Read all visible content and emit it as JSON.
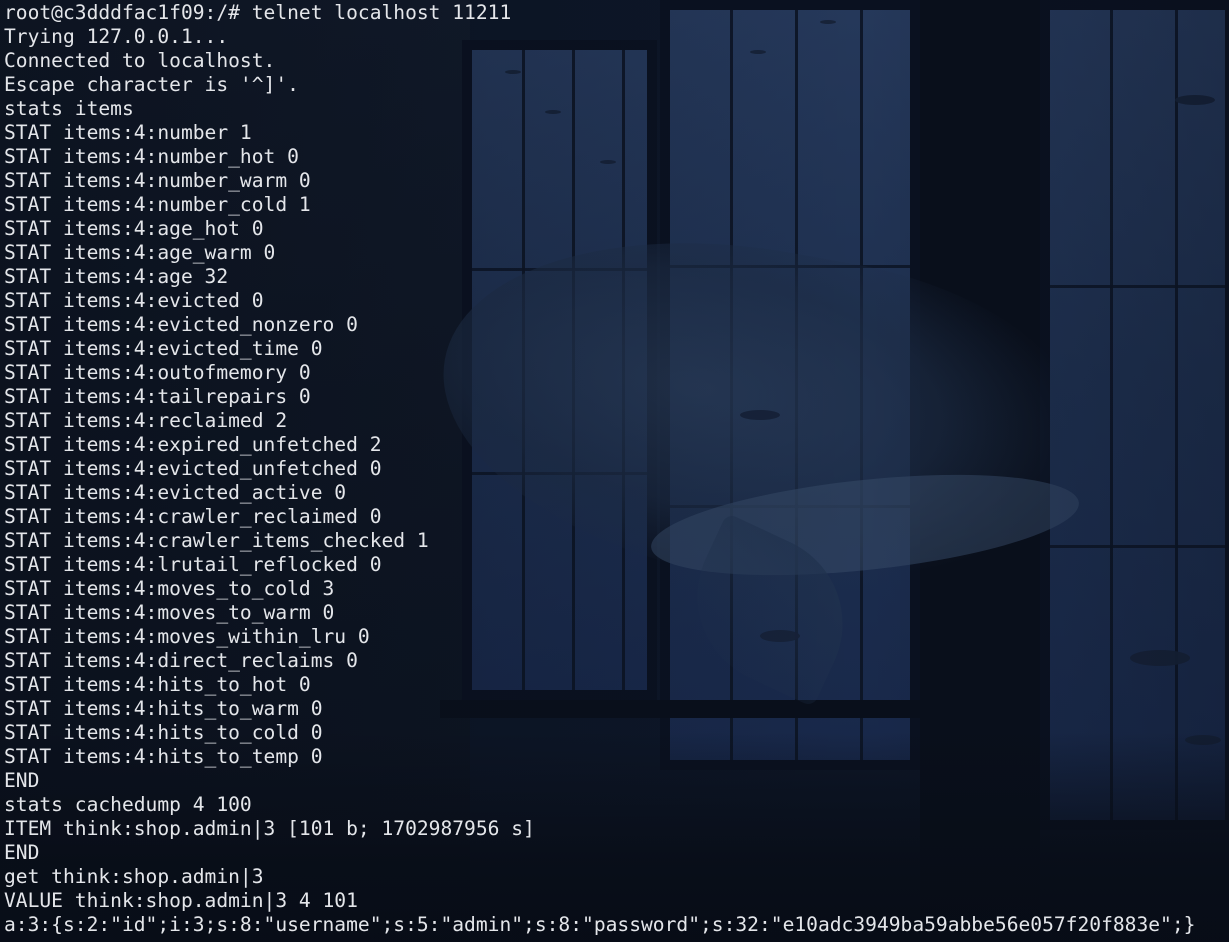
{
  "terminal": {
    "foreground": "#e4e6ea",
    "background_image": "anime night scene: classroom windows with a whale and fish outside",
    "lines": [
      "root@c3dddfac1f09:/# telnet localhost 11211",
      "Trying 127.0.0.1...",
      "Connected to localhost.",
      "Escape character is '^]'.",
      "stats items",
      "STAT items:4:number 1",
      "STAT items:4:number_hot 0",
      "STAT items:4:number_warm 0",
      "STAT items:4:number_cold 1",
      "STAT items:4:age_hot 0",
      "STAT items:4:age_warm 0",
      "STAT items:4:age 32",
      "STAT items:4:evicted 0",
      "STAT items:4:evicted_nonzero 0",
      "STAT items:4:evicted_time 0",
      "STAT items:4:outofmemory 0",
      "STAT items:4:tailrepairs 0",
      "STAT items:4:reclaimed 2",
      "STAT items:4:expired_unfetched 2",
      "STAT items:4:evicted_unfetched 0",
      "STAT items:4:evicted_active 0",
      "STAT items:4:crawler_reclaimed 0",
      "STAT items:4:crawler_items_checked 1",
      "STAT items:4:lrutail_reflocked 0",
      "STAT items:4:moves_to_cold 3",
      "STAT items:4:moves_to_warm 0",
      "STAT items:4:moves_within_lru 0",
      "STAT items:4:direct_reclaims 0",
      "STAT items:4:hits_to_hot 0",
      "STAT items:4:hits_to_warm 0",
      "STAT items:4:hits_to_cold 0",
      "STAT items:4:hits_to_temp 0",
      "END",
      "stats cachedump 4 100",
      "ITEM think:shop.admin|3 [101 b; 1702987956 s]",
      "END",
      "get think:shop.admin|3",
      "VALUE think:shop.admin|3 4 101",
      "a:3:{s:2:\"id\";i:3;s:8:\"username\";s:5:\"admin\";s:8:\"password\";s:32:\"e10adc3949ba59abbe56e057f20f883e\";}"
    ]
  }
}
